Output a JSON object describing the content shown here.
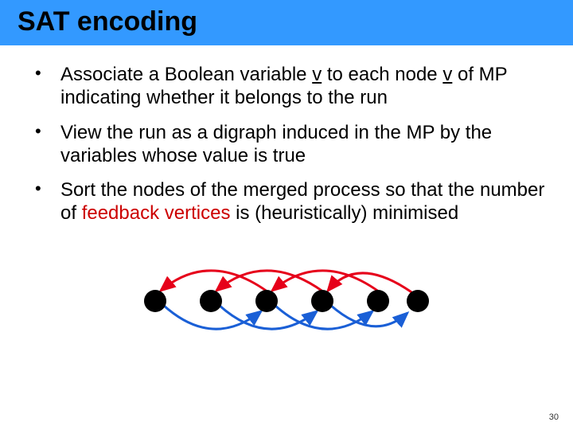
{
  "title": "SAT encoding",
  "bullets": {
    "b1_pre": "Associate a Boolean variable ",
    "b1_var1": "v",
    "b1_mid": " to each node ",
    "b1_var2": "v",
    "b1_post": " of MP indicating whether it belongs to the run",
    "b2": "View the run as a digraph induced in the MP by the variables whose value is true",
    "b3_pre": "Sort the nodes of the merged process so that the number of ",
    "b3_fb": "feedback vertices",
    "b3_post": " is (heuristically) minimised"
  },
  "page_number": "30",
  "colors": {
    "title_bg": "#3399ff",
    "feedback_text": "#cc0000",
    "arc_back": "#e6001a",
    "arc_fwd": "#1a5fd6"
  }
}
